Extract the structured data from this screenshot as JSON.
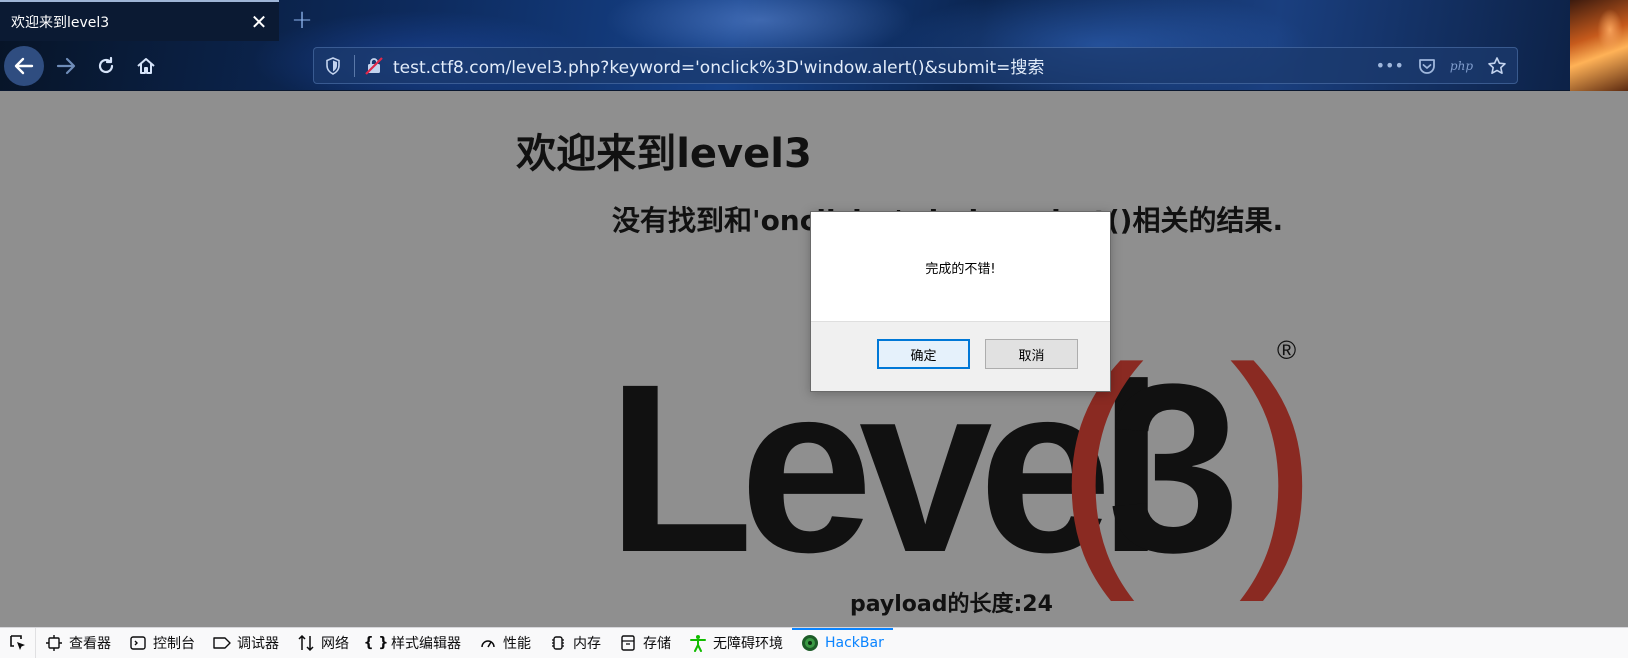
{
  "browser": {
    "tab_title": "欢迎来到level3",
    "url": "test.ctf8.com/level3.php?keyword='onclick%3D'window.alert()&submit=搜索"
  },
  "page": {
    "title": "欢迎来到level3",
    "result_text": "没有找到和'onclick='window.alert()相关的结果.",
    "payload_length": "payload的长度:24"
  },
  "dialog": {
    "message": "完成的不错!",
    "ok_label": "确定",
    "cancel_label": "取消"
  },
  "devtools": {
    "tabs": [
      {
        "label": "查看器",
        "icon": "inspector-icon"
      },
      {
        "label": "控制台",
        "icon": "console-icon"
      },
      {
        "label": "调试器",
        "icon": "debugger-icon"
      },
      {
        "label": "网络",
        "icon": "network-icon"
      },
      {
        "label": "样式编辑器",
        "icon": "style-editor-icon"
      },
      {
        "label": "性能",
        "icon": "performance-icon"
      },
      {
        "label": "内存",
        "icon": "memory-icon"
      },
      {
        "label": "存储",
        "icon": "storage-icon"
      },
      {
        "label": "无障碍环境",
        "icon": "accessibility-icon"
      },
      {
        "label": "HackBar",
        "icon": "hackbar-icon"
      }
    ],
    "active_tab": "HackBar"
  },
  "logo": {
    "text": "Level(3)",
    "registered_mark": "®"
  },
  "colors": {
    "page_bg": "#8f8f8f",
    "devtools_active": "#0a84ff",
    "logo_paren": "#8a2a22"
  }
}
